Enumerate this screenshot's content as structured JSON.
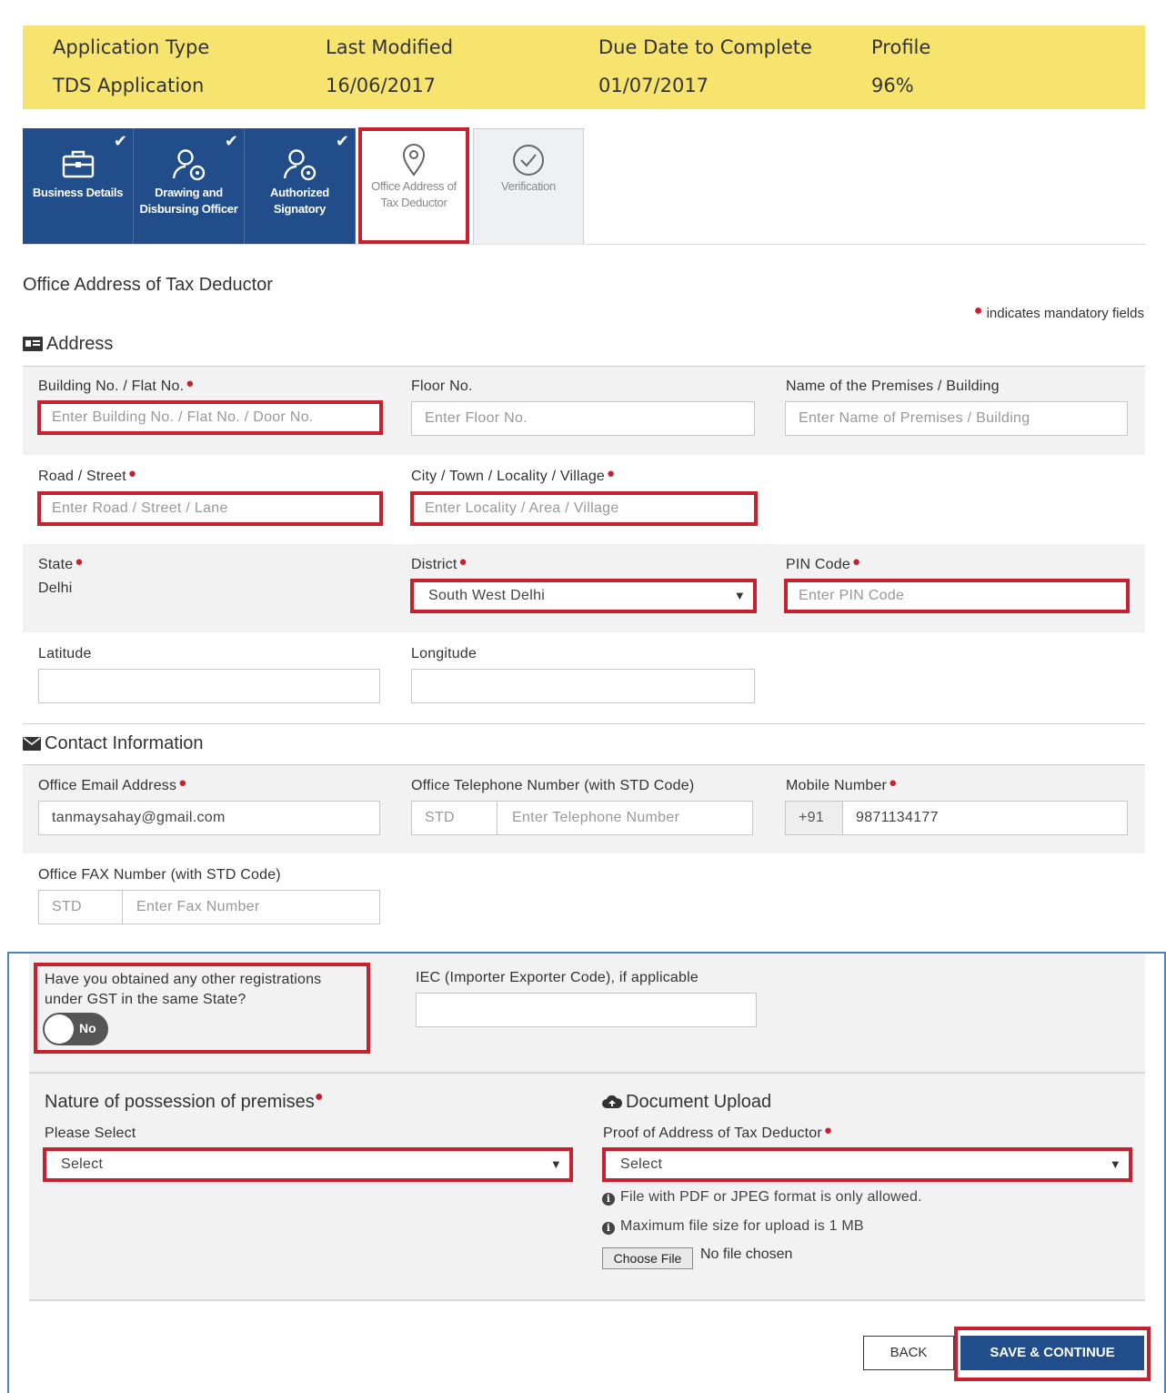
{
  "header": {
    "application_type_label": "Application Type",
    "application_type_value": "TDS Application",
    "last_modified_label": "Last Modified",
    "last_modified_value": "16/06/2017",
    "due_date_label": "Due Date to Complete",
    "due_date_value": "01/07/2017",
    "profile_label": "Profile",
    "profile_value": "96%"
  },
  "tabs": [
    {
      "label": "Business Details",
      "icon": "briefcase-icon",
      "state": "done"
    },
    {
      "label": "Drawing and Disbursing Officer",
      "icon": "user-gear-icon",
      "state": "done"
    },
    {
      "label": "Authorized Signatory",
      "icon": "user-gear-icon",
      "state": "done"
    },
    {
      "label": "Office Address of Tax Deductor",
      "icon": "map-pin-icon",
      "state": "current"
    },
    {
      "label": "Verification",
      "icon": "check-circle-icon",
      "state": "pending"
    }
  ],
  "page_title": "Office Address of Tax Deductor",
  "mandatory_note": "indicates mandatory fields",
  "address": {
    "heading": "Address",
    "building_label": "Building No. / Flat No.",
    "building_placeholder": "Enter Building No. / Flat No. / Door No.",
    "floor_label": "Floor No.",
    "floor_placeholder": "Enter Floor No.",
    "premises_label": "Name of the Premises / Building",
    "premises_placeholder": "Enter Name of Premises / Building",
    "road_label": "Road / Street",
    "road_placeholder": "Enter Road / Street / Lane",
    "city_label": "City / Town / Locality / Village",
    "city_placeholder": "Enter Locality / Area / Village",
    "state_label": "State",
    "state_value": "Delhi",
    "district_label": "District",
    "district_value": "South West Delhi",
    "pin_label": "PIN Code",
    "pin_placeholder": "Enter PIN Code",
    "latitude_label": "Latitude",
    "latitude_value": "",
    "longitude_label": "Longitude",
    "longitude_value": ""
  },
  "contact": {
    "heading": "Contact Information",
    "email_label": "Office Email Address",
    "email_value": "tanmaysahay@gmail.com",
    "phone_label": "Office Telephone Number (with STD Code)",
    "phone_std_placeholder": "STD",
    "phone_placeholder": "Enter Telephone Number",
    "mobile_label": "Mobile Number",
    "mobile_prefix": "+91",
    "mobile_value": "9871134177",
    "fax_label": "Office FAX Number (with STD Code)",
    "fax_std_placeholder": "STD",
    "fax_placeholder": "Enter Fax Number"
  },
  "other_reg": {
    "question": "Have you obtained any other registrations under GST in the same State?",
    "toggle_text": "No",
    "iec_label": "IEC (Importer Exporter Code), if applicable",
    "iec_value": ""
  },
  "possession": {
    "heading": "Nature of possession of premises",
    "select_label": "Please Select",
    "select_value": "Select"
  },
  "upload": {
    "heading": "Document Upload",
    "proof_label": "Proof of Address of Tax Deductor",
    "proof_value": "Select",
    "hint_format": "File with PDF or JPEG format is only allowed.",
    "hint_size": "Maximum file size for upload is 1 MB",
    "choose_file": "Choose File",
    "file_status": "No file chosen"
  },
  "actions": {
    "back": "BACK",
    "save": "SAVE & CONTINUE"
  },
  "colors": {
    "header_bg": "#f7e46f",
    "tab_blue": "#214e8a",
    "highlight_red": "#c8202f",
    "band_grey": "#f2f2f2"
  }
}
